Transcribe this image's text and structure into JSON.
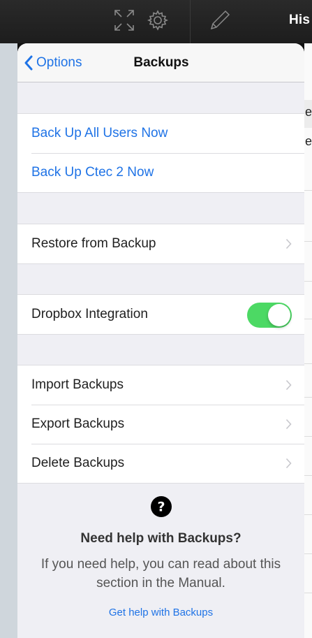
{
  "background": {
    "header_title_fragment": "His",
    "row_fragment_1": "e",
    "row_fragment_2": "er"
  },
  "icons": {
    "expand": "expand-arrows-icon",
    "settings": "gear-icon",
    "edit": "pencil-icon",
    "back": "chevron-left-icon",
    "disclosure": "chevron-right-icon",
    "help": "question-circle-icon"
  },
  "colors": {
    "accent": "#1f73e6",
    "switch_on": "#4cd964",
    "group_background": "#efeff4"
  },
  "nav": {
    "back_label": "Options",
    "title": "Backups"
  },
  "groups": {
    "backup_actions": [
      {
        "label": "Back Up All Users Now"
      },
      {
        "label": "Back Up Ctec 2 Now"
      }
    ],
    "restore": {
      "label": "Restore from Backup"
    },
    "dropbox": {
      "label": "Dropbox Integration",
      "enabled": true
    },
    "manage": [
      {
        "label": "Import Backups"
      },
      {
        "label": "Export Backups"
      },
      {
        "label": "Delete Backups"
      }
    ]
  },
  "help": {
    "title": "Need help with Backups?",
    "text": "If you need help, you can read about this section in the Manual.",
    "link": "Get help with Backups"
  }
}
